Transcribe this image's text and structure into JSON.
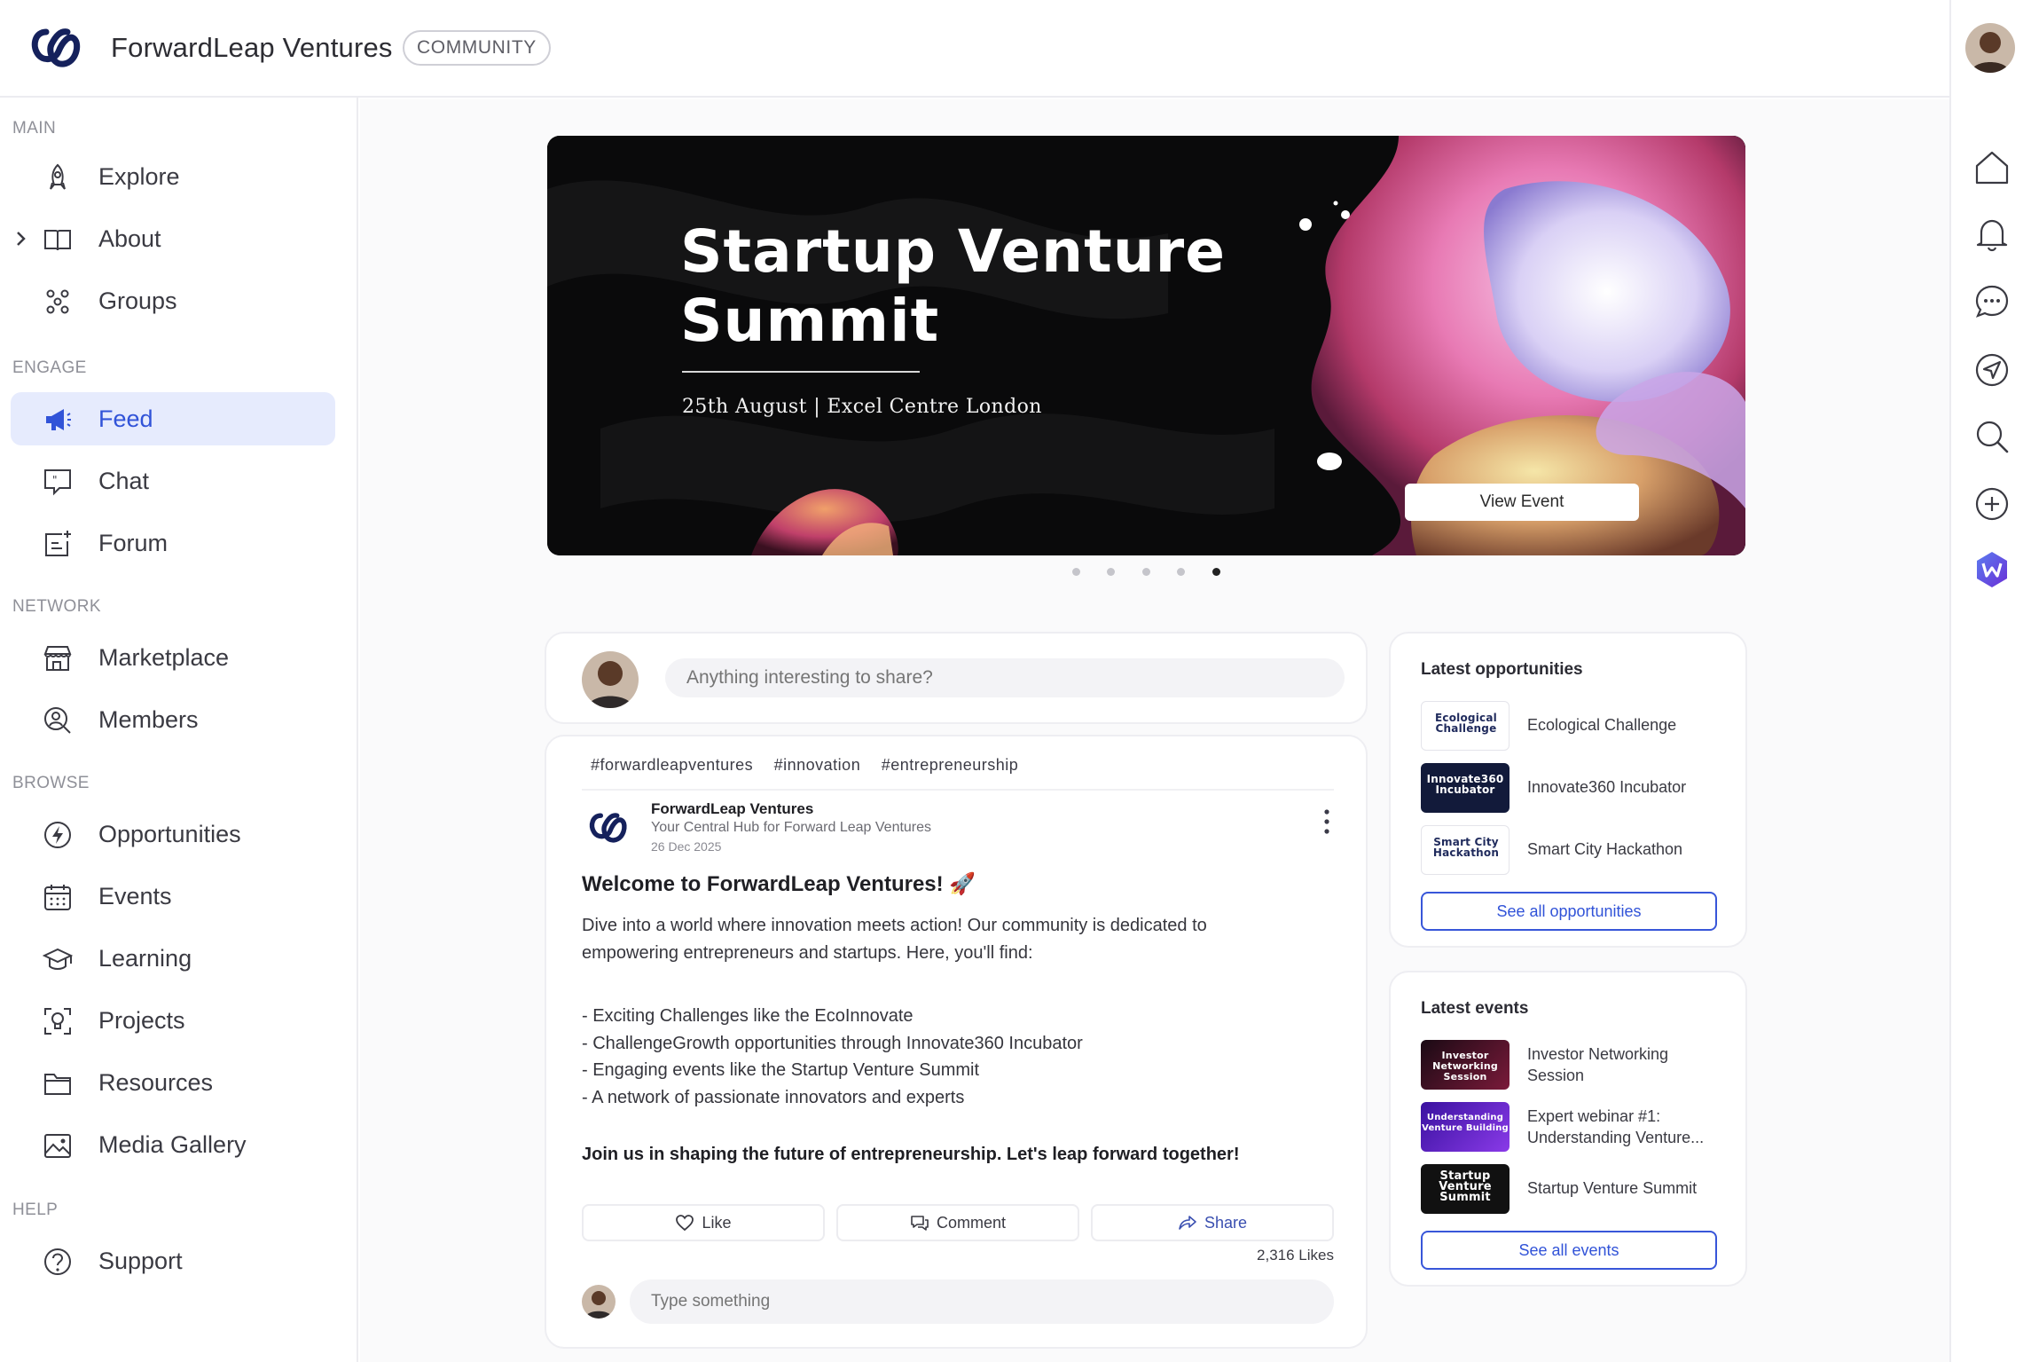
{
  "header": {
    "brand": "ForwardLeap Ventures",
    "badge": "COMMUNITY",
    "logo_icon": "forwardleap-logo-icon",
    "avatar_icon": "user-avatar"
  },
  "sidebar": {
    "sections": [
      {
        "title": "MAIN",
        "items": [
          {
            "label": "Explore",
            "icon": "rocket-icon"
          },
          {
            "label": "About",
            "icon": "book-icon",
            "expandable": true
          },
          {
            "label": "Groups",
            "icon": "groups-icon"
          }
        ]
      },
      {
        "title": "ENGAGE",
        "items": [
          {
            "label": "Feed",
            "icon": "megaphone-icon",
            "active": true
          },
          {
            "label": "Chat",
            "icon": "chat-icon"
          },
          {
            "label": "Forum",
            "icon": "forum-icon"
          }
        ]
      },
      {
        "title": "NETWORK",
        "items": [
          {
            "label": "Marketplace",
            "icon": "store-icon"
          },
          {
            "label": "Members",
            "icon": "members-icon"
          }
        ]
      },
      {
        "title": "BROWSE",
        "items": [
          {
            "label": "Opportunities",
            "icon": "bolt-icon"
          },
          {
            "label": "Events",
            "icon": "calendar-icon"
          },
          {
            "label": "Learning",
            "icon": "graduation-cap-icon"
          },
          {
            "label": "Projects",
            "icon": "projects-icon"
          },
          {
            "label": "Resources",
            "icon": "folder-icon"
          },
          {
            "label": "Media Gallery",
            "icon": "image-icon"
          }
        ]
      },
      {
        "title": "HELP",
        "items": [
          {
            "label": "Support",
            "icon": "help-icon"
          }
        ]
      }
    ]
  },
  "right_rail": {
    "icons": [
      "home-icon",
      "bell-icon",
      "messages-icon",
      "send-icon",
      "search-icon",
      "add-icon",
      "w-app-icon"
    ]
  },
  "banner": {
    "title_line1": "Startup Venture",
    "title_line2": "Summit",
    "subtitle": "25th August | Excel Centre London",
    "button": "View Event",
    "slides_total": 5,
    "active_slide": 5
  },
  "composer": {
    "placeholder": "Anything interesting to share?"
  },
  "post": {
    "tags": [
      "#forwardleapventures",
      "#innovation",
      "#entrepreneurship"
    ],
    "author": "ForwardLeap Ventures",
    "tagline": "Your Central Hub for Forward Leap Ventures",
    "date": "26 Dec 2025",
    "heading": "Welcome to ForwardLeap Ventures! 🚀",
    "intro_line1": "Dive into a world where innovation meets action! Our community is dedicated to",
    "intro_line2": "empowering entrepreneurs and startups. Here, you'll find:",
    "bullets": [
      "- Exciting Challenges like the EcoInnovate",
      "- ChallengeGrowth opportunities through Innovate360 Incubator",
      "- Engaging events like the Startup Venture Summit",
      "- A network of passionate innovators and experts"
    ],
    "cta": "Join us in shaping the future of entrepreneurship. Let's leap forward together!",
    "actions": {
      "like": "Like",
      "comment": "Comment",
      "share": "Share"
    },
    "likes": "2,316 Likes",
    "reply_placeholder": "Type something"
  },
  "opportunities": {
    "title": "Latest opportunities",
    "items": [
      {
        "name": "Ecological Challenge",
        "thumb": "Ecological Challenge",
        "thumb_bg": "#ffffff",
        "thumb_fg": "#1f2a5c"
      },
      {
        "name": "Innovate360 Incubator",
        "thumb": "Innovate360 Incubator",
        "thumb_bg": "#121a3a",
        "thumb_fg": "#ffffff"
      },
      {
        "name": "Smart City Hackathon",
        "thumb": "Smart City Hackathon",
        "thumb_bg": "#ffffff",
        "thumb_fg": "#1f2a5c"
      }
    ],
    "see_all": "See all opportunities"
  },
  "events": {
    "title": "Latest events",
    "items": [
      {
        "name_line1": "Investor Networking",
        "name_line2": "Session",
        "thumb": "Investor Networking Session",
        "thumb_bg": "#2a0f20"
      },
      {
        "name_line1": "Expert webinar #1:",
        "name_line2": "Understanding Venture...",
        "thumb": "Understanding Venture Building",
        "thumb_bg": "#4a1bb5"
      },
      {
        "name_line1": "Startup Venture Summit",
        "name_line2": "",
        "thumb": "Startup Venture Summit",
        "thumb_bg": "#111111"
      }
    ],
    "see_all": "See all events"
  },
  "colors": {
    "accent": "#3153d8",
    "active_nav_bg": "#e6ebfd",
    "logo_navy": "#15215c"
  }
}
